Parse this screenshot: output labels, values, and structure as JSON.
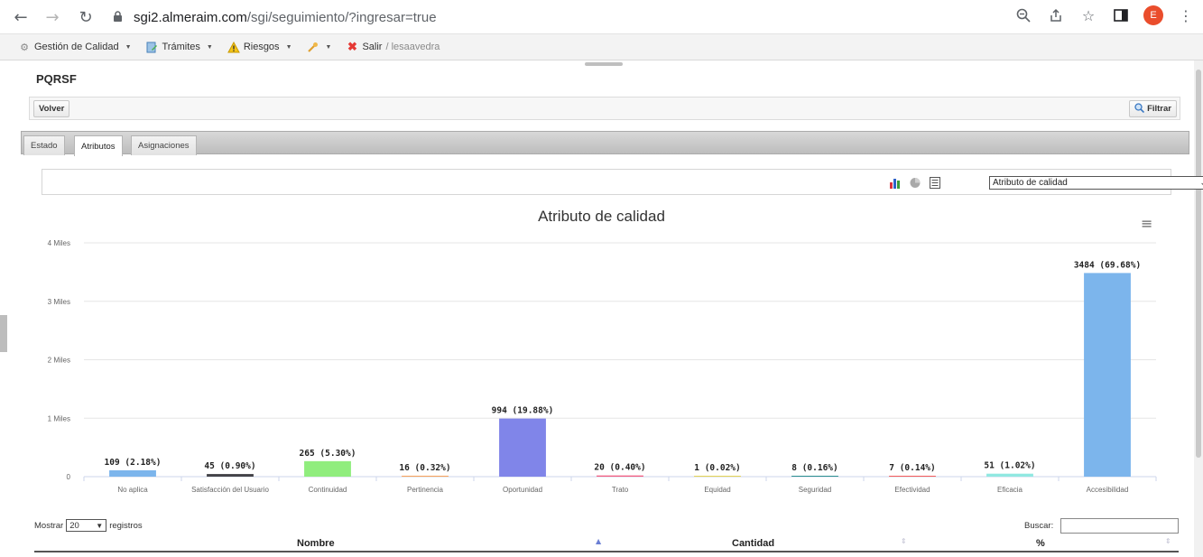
{
  "browser": {
    "url_host": "sgi2.almeraim.com",
    "url_path": "/sgi/seguimiento/?ingresar=true",
    "avatar_letter": "E"
  },
  "menu": {
    "items": [
      {
        "label": "Gestión de Calidad",
        "icon": "gear-icon"
      },
      {
        "label": "Trámites",
        "icon": "document-icon"
      },
      {
        "label": "Riesgos",
        "icon": "warning-icon"
      },
      {
        "label": "",
        "icon": "wrench-icon"
      },
      {
        "label": "Salir",
        "icon": "close-icon"
      }
    ],
    "user": "/ lesaavedra"
  },
  "page": {
    "title": "PQRSF",
    "back_label": "Volver",
    "filter_label": "Filtrar"
  },
  "tabs": [
    {
      "label": "Estado",
      "active": false
    },
    {
      "label": "Atributos",
      "active": true
    },
    {
      "label": "Asignaciones",
      "active": false
    }
  ],
  "chart_select": {
    "value": "Atributo de calidad"
  },
  "colors": {
    "accent": "#7cb5ec"
  },
  "chart_data": {
    "type": "bar",
    "title": "Atributo de calidad",
    "xlabel": "",
    "ylabel": "",
    "ylim": [
      0,
      4000
    ],
    "yticks": [
      {
        "value": 0,
        "label": "0"
      },
      {
        "value": 1000,
        "label": "1 Miles"
      },
      {
        "value": 2000,
        "label": "2 Miles"
      },
      {
        "value": 3000,
        "label": "3 Miles"
      },
      {
        "value": 4000,
        "label": "4 Miles"
      }
    ],
    "categories": [
      "No aplica",
      "Satisfacción del Usuario",
      "Continuidad",
      "Pertinencia",
      "Oportunidad",
      "Trato",
      "Equidad",
      "Seguridad",
      "Efectividad",
      "Eficacia",
      "Accesibilidad"
    ],
    "values": [
      109,
      45,
      265,
      16,
      994,
      20,
      1,
      8,
      7,
      51,
      3484
    ],
    "data_labels": [
      "109 (2.18%)",
      "45 (0.90%)",
      "265 (5.30%)",
      "16 (0.32%)",
      "994 (19.88%)",
      "20 (0.40%)",
      "1 (0.02%)",
      "8 (0.16%)",
      "7 (0.14%)",
      "51 (1.02%)",
      "3484 (69.68%)"
    ],
    "colors": [
      "#7cb5ec",
      "#434348",
      "#90ed7d",
      "#f7a35c",
      "#8085e9",
      "#f15c80",
      "#e4d354",
      "#2b908f",
      "#f45b5b",
      "#91e8e1",
      "#7cb5ec"
    ],
    "grid": true,
    "legend": "none"
  },
  "table": {
    "show_prefix": "Mostrar",
    "page_length": "20",
    "show_suffix": "registros",
    "search_label": "Buscar:",
    "columns": [
      "Nombre",
      "Cantidad",
      "%"
    ]
  }
}
